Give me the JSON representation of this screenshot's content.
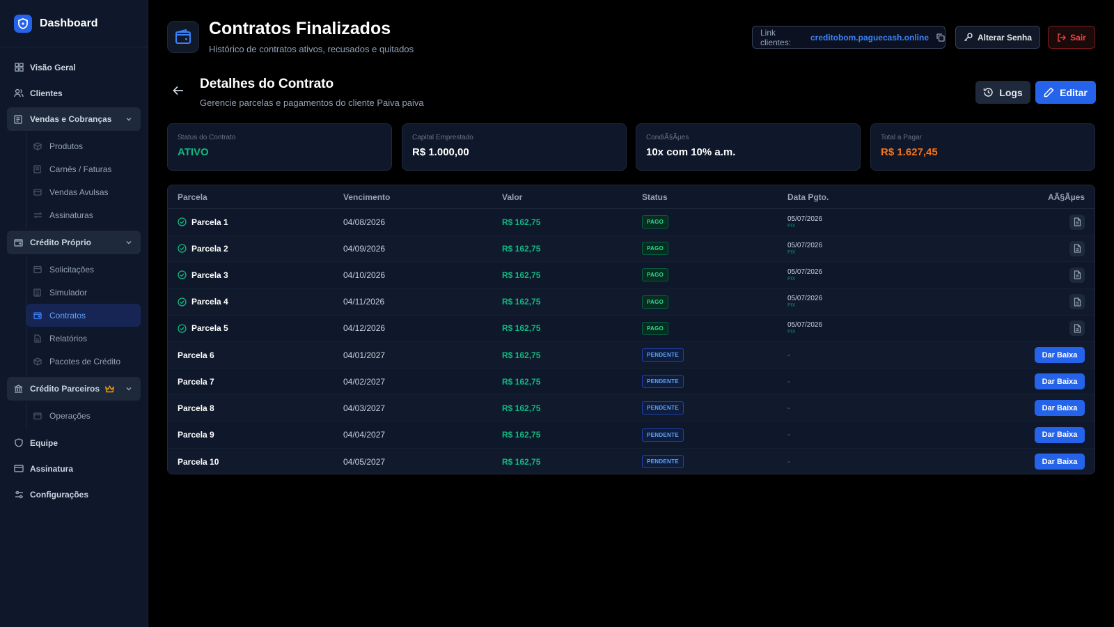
{
  "sidebar": {
    "brand": "Dashboard",
    "items": [
      {
        "label": "Visão Geral",
        "icon": "grid-icon"
      },
      {
        "label": "Clientes",
        "icon": "users-icon"
      }
    ],
    "group_vendas": {
      "label": "Vendas e Cobranças",
      "items": [
        "Produtos",
        "Carnês / Faturas",
        "Vendas Avulsas",
        "Assinaturas"
      ]
    },
    "group_credito": {
      "label": "Crédito Próprio",
      "items": [
        "Solicitações",
        "Simulador",
        "Contratos",
        "Relatórios",
        "Pacotes de Crédito"
      ],
      "active": "Contratos"
    },
    "group_parceiros": {
      "label": "Crédito Parceiros",
      "items": [
        "Operações"
      ]
    },
    "bottom_items": [
      "Equipe",
      "Assinatura",
      "Configurações"
    ]
  },
  "header": {
    "title": "Contratos Finalizados",
    "subtitle": "Histórico de contratos ativos, recusados e quitados",
    "link_label": "Link clientes:",
    "link_url": "creditobom.paguecash.online",
    "change_password": "Alterar Senha",
    "logout": "Sair"
  },
  "detail": {
    "title": "Detalhes do Contrato",
    "subtitle": "Gerencie parcelas e pagamentos do cliente Paiva paiva",
    "logs_label": "Logs",
    "edit_label": "Editar"
  },
  "cards": [
    {
      "label": "Status do Contrato",
      "value": "ATIVO",
      "color": "#10b981"
    },
    {
      "label": "Capital Emprestado",
      "value": "R$ 1.000,00",
      "color": "#ffffff"
    },
    {
      "label": "CondiÃ§Ãµes",
      "value": "10x com 10% a.m.",
      "color": "#ffffff"
    },
    {
      "label": "Total a Pagar",
      "value": "R$ 1.627,45",
      "color": "#f97316"
    }
  ],
  "table": {
    "headers": {
      "parcela": "Parcela",
      "vencimento": "Vencimento",
      "valor": "Valor",
      "status": "Status",
      "data": "Data Pgto.",
      "acoes": "AÃ§Ãµes"
    },
    "rows": [
      {
        "parcela": "Parcela 1",
        "vencimento": "04/08/2026",
        "valor": "R$ 162,75",
        "status": "PAGO",
        "paid": true,
        "data": "05/07/2026",
        "method": "PIX"
      },
      {
        "parcela": "Parcela 2",
        "vencimento": "04/09/2026",
        "valor": "R$ 162,75",
        "status": "PAGO",
        "paid": true,
        "data": "05/07/2026",
        "method": "PIX"
      },
      {
        "parcela": "Parcela 3",
        "vencimento": "04/10/2026",
        "valor": "R$ 162,75",
        "status": "PAGO",
        "paid": true,
        "data": "05/07/2026",
        "method": "PIX"
      },
      {
        "parcela": "Parcela 4",
        "vencimento": "04/11/2026",
        "valor": "R$ 162,75",
        "status": "PAGO",
        "paid": true,
        "data": "05/07/2026",
        "method": "PIX"
      },
      {
        "parcela": "Parcela 5",
        "vencimento": "04/12/2026",
        "valor": "R$ 162,75",
        "status": "PAGO",
        "paid": true,
        "data": "05/07/2026",
        "method": "PIX"
      },
      {
        "parcela": "Parcela 6",
        "vencimento": "04/01/2027",
        "valor": "R$ 162,75",
        "status": "PENDENTE",
        "paid": false,
        "data": "-",
        "action": "Dar Baixa"
      },
      {
        "parcela": "Parcela 7",
        "vencimento": "04/02/2027",
        "valor": "R$ 162,75",
        "status": "PENDENTE",
        "paid": false,
        "data": "-",
        "action": "Dar Baixa"
      },
      {
        "parcela": "Parcela 8",
        "vencimento": "04/03/2027",
        "valor": "R$ 162,75",
        "status": "PENDENTE",
        "paid": false,
        "data": "-",
        "action": "Dar Baixa"
      },
      {
        "parcela": "Parcela 9",
        "vencimento": "04/04/2027",
        "valor": "R$ 162,75",
        "status": "PENDENTE",
        "paid": false,
        "data": "-",
        "action": "Dar Baixa"
      },
      {
        "parcela": "Parcela 10",
        "vencimento": "04/05/2027",
        "valor": "R$ 162,75",
        "status": "PENDENTE",
        "paid": false,
        "data": "-",
        "action": "Dar Baixa"
      }
    ]
  },
  "colors": {
    "accent": "#2563eb",
    "success": "#10b981",
    "warning": "#f97316",
    "danger": "#ef4444"
  }
}
